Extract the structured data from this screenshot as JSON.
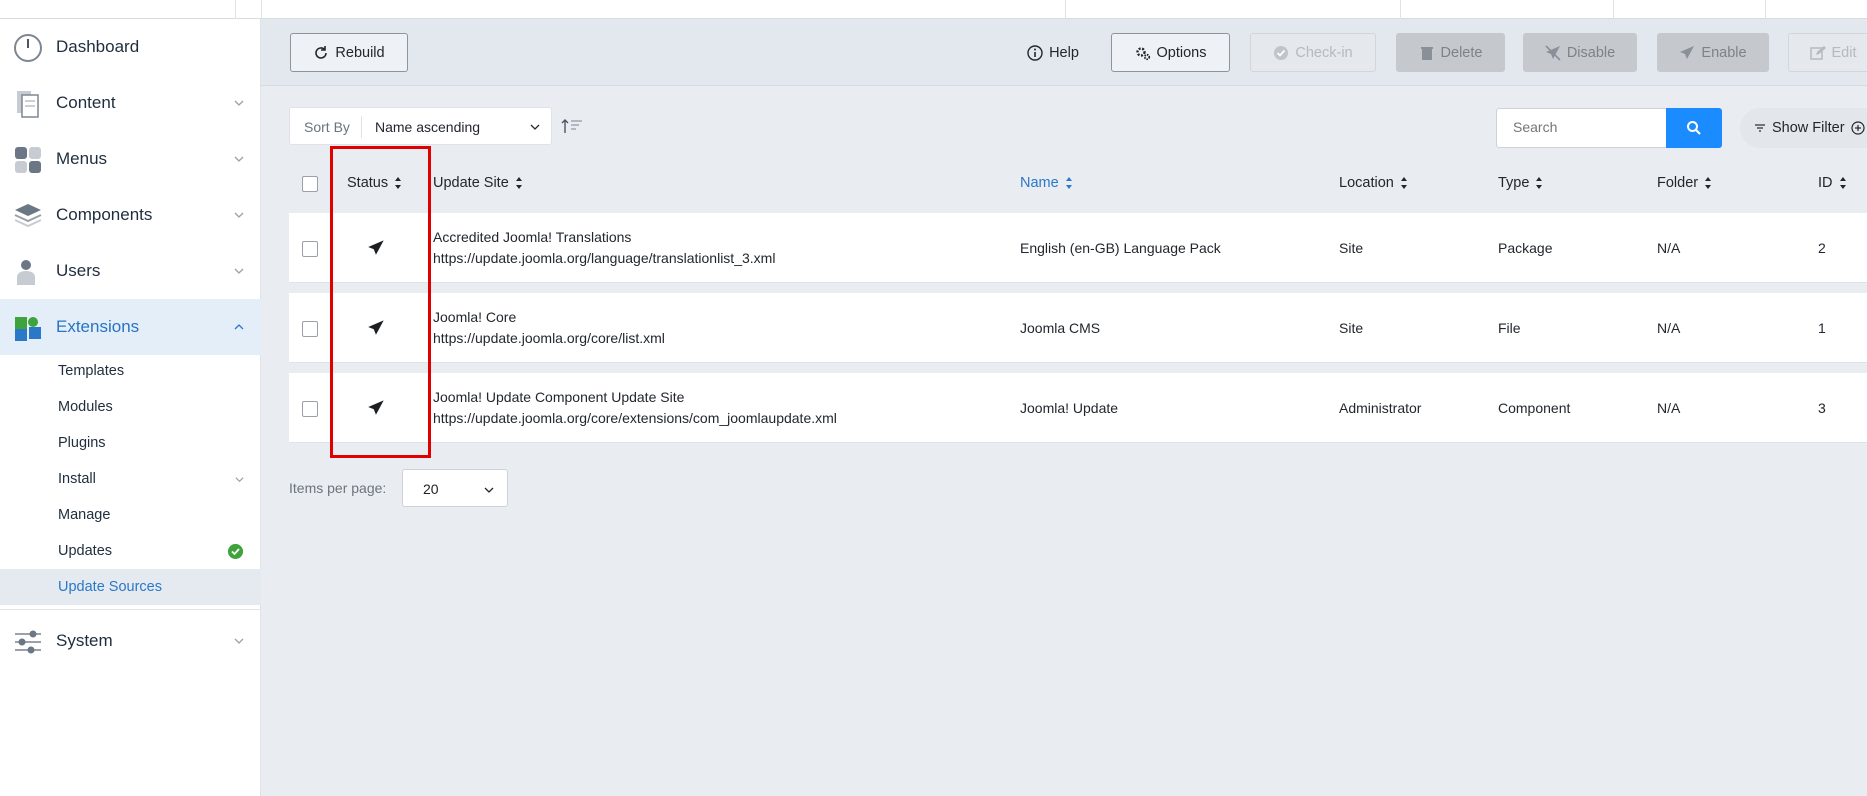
{
  "sidebar": {
    "main": [
      {
        "label": "Dashboard",
        "icon": "dashboard-icon"
      },
      {
        "label": "Content",
        "icon": "content-icon"
      },
      {
        "label": "Menus",
        "icon": "menus-icon"
      },
      {
        "label": "Components",
        "icon": "components-icon"
      },
      {
        "label": "Users",
        "icon": "users-icon"
      },
      {
        "label": "Extensions",
        "icon": "extensions-icon"
      },
      {
        "label": "System",
        "icon": "system-icon"
      }
    ],
    "sub": [
      {
        "label": "Templates"
      },
      {
        "label": "Modules"
      },
      {
        "label": "Plugins"
      },
      {
        "label": "Install"
      },
      {
        "label": "Manage"
      },
      {
        "label": "Updates"
      },
      {
        "label": "Update Sources"
      }
    ]
  },
  "toolbar": {
    "rebuild": "Rebuild",
    "help": "Help",
    "options": "Options",
    "checkin": "Check-in",
    "delete": "Delete",
    "disable": "Disable",
    "enable": "Enable",
    "edit": "Edit"
  },
  "filters": {
    "sort_by_label": "Sort By",
    "sort_value": "Name ascending",
    "search_placeholder": "Search",
    "show_filter": "Show Filter"
  },
  "table": {
    "columns": [
      "Status",
      "Update Site",
      "Name",
      "Location",
      "Type",
      "Folder",
      "ID"
    ],
    "rows": [
      {
        "site": "Accredited Joomla! Translations",
        "url": "https://update.joomla.org/language/translationlist_3.xml",
        "name": "English (en-GB) Language Pack",
        "location": "Site",
        "type": "Package",
        "folder": "N/A",
        "id": "2"
      },
      {
        "site": "Joomla! Core",
        "url": "https://update.joomla.org/core/list.xml",
        "name": "Joomla CMS",
        "location": "Site",
        "type": "File",
        "folder": "N/A",
        "id": "1"
      },
      {
        "site": "Joomla! Update Component Update Site",
        "url": "https://update.joomla.org/core/extensions/com_joomlaupdate.xml",
        "name": "Joomla! Update",
        "location": "Administrator",
        "type": "Component",
        "folder": "N/A",
        "id": "3"
      }
    ]
  },
  "pagination": {
    "items_per_page_label": "Items per page:",
    "items_per_page": "20"
  },
  "colors": {
    "accent": "#1a8cff",
    "highlight": "#e00000",
    "active_text": "#2a78c8"
  }
}
